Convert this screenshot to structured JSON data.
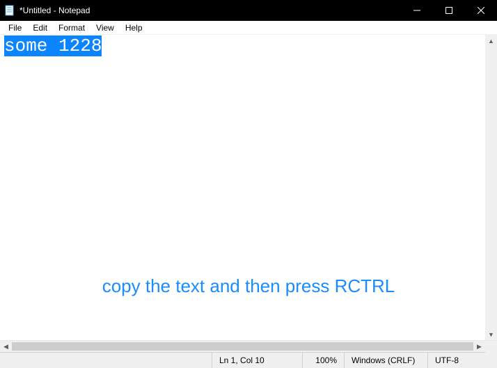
{
  "titlebar": {
    "title": "*Untitled - Notepad"
  },
  "menu": {
    "file": "File",
    "edit": "Edit",
    "format": "Format",
    "view": "View",
    "help": "Help"
  },
  "editor": {
    "selected_text": "some 1228"
  },
  "statusbar": {
    "position": "Ln 1, Col 10",
    "zoom": "100%",
    "line_ending": "Windows (CRLF)",
    "encoding": "UTF-8"
  },
  "instruction": "copy the text and then press RCTRL"
}
